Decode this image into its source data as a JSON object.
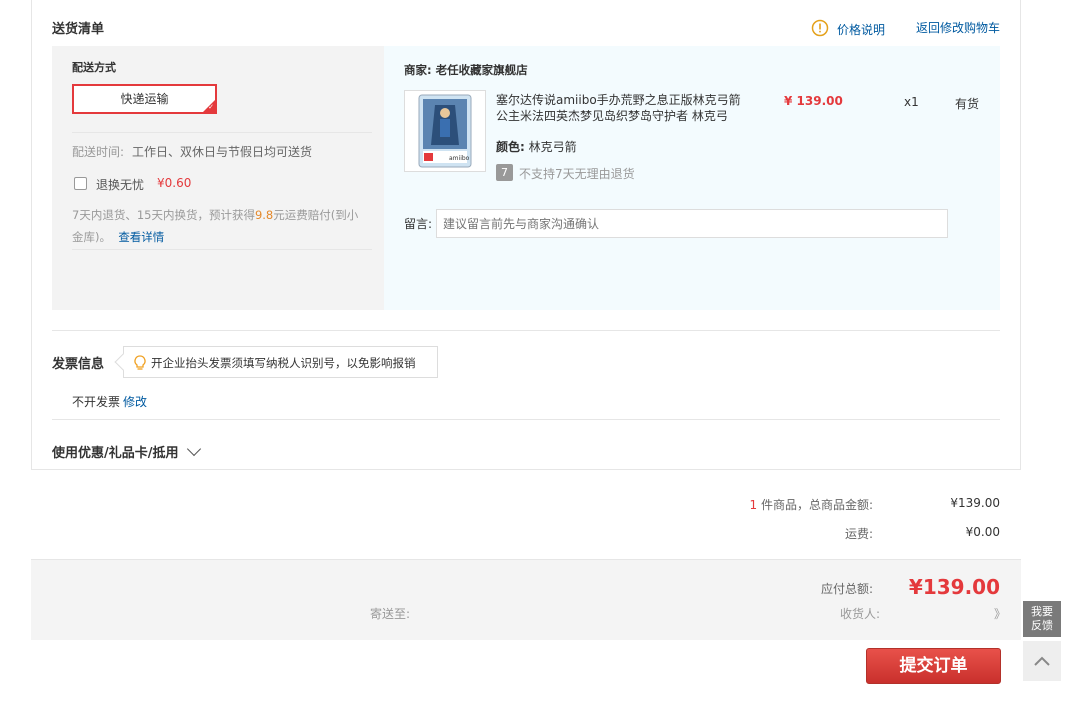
{
  "header": {
    "title": "送货清单",
    "price_info_label": "价格说明",
    "back_to_cart_label": "返回修改购物车"
  },
  "shipping": {
    "title": "配送方式",
    "method_label": "快递运输",
    "time_label": "配送时间:",
    "time_value": "工作日、双休日与节假日均可送货",
    "worry_free_label": "退换无忧",
    "worry_free_price": "¥0.60",
    "policy_text_1": "7天内退货、15天内换货，预计获得",
    "policy_amount": "9.8",
    "policy_text_2": "元运费赔付(到小",
    "policy_text_3": "金库)。",
    "policy_link": "查看详情"
  },
  "order": {
    "merchant_label": "商家:",
    "merchant_name": "老任收藏家旗舰店",
    "product_title_1": "塞尔达传说amiibo手办荒野之息正版林克弓箭",
    "product_title_2": "公主米法四英杰梦见岛织梦岛守护者 林克弓",
    "price": "¥ 139.00",
    "quantity": "x1",
    "stock": "有货",
    "color_label": "颜色:",
    "color_value": "林克弓箭",
    "return_badge": "7",
    "return_policy": "不支持7天无理由退货",
    "message_label": "留言:",
    "message_placeholder": "建议留言前先与商家沟通确认",
    "thumb_brand": "amiibo"
  },
  "invoice": {
    "title": "发票信息",
    "tip": "开企业抬头发票须填写纳税人识别号，以免影响报销",
    "status": "不开发票",
    "edit_label": "修改"
  },
  "coupon": {
    "title": "使用优惠/礼品卡/抵用"
  },
  "summary": {
    "item_count": "1",
    "item_total_label": "件商品，总商品金额:",
    "item_total": "¥139.00",
    "shipping_label": "运费:",
    "shipping_fee": "¥0.00",
    "payable_label": "应付总额:",
    "payable_total": "¥139.00",
    "ship_to_label": "寄送至:",
    "receiver_label": "收货人:",
    "receiver_fragment": "》"
  },
  "actions": {
    "submit_label": "提交订单",
    "feedback_line1": "我要",
    "feedback_line2": "反馈"
  },
  "colors": {
    "accent_red": "#e4393c",
    "link_blue": "#005aa0",
    "policy_orange": "#e4892b"
  }
}
